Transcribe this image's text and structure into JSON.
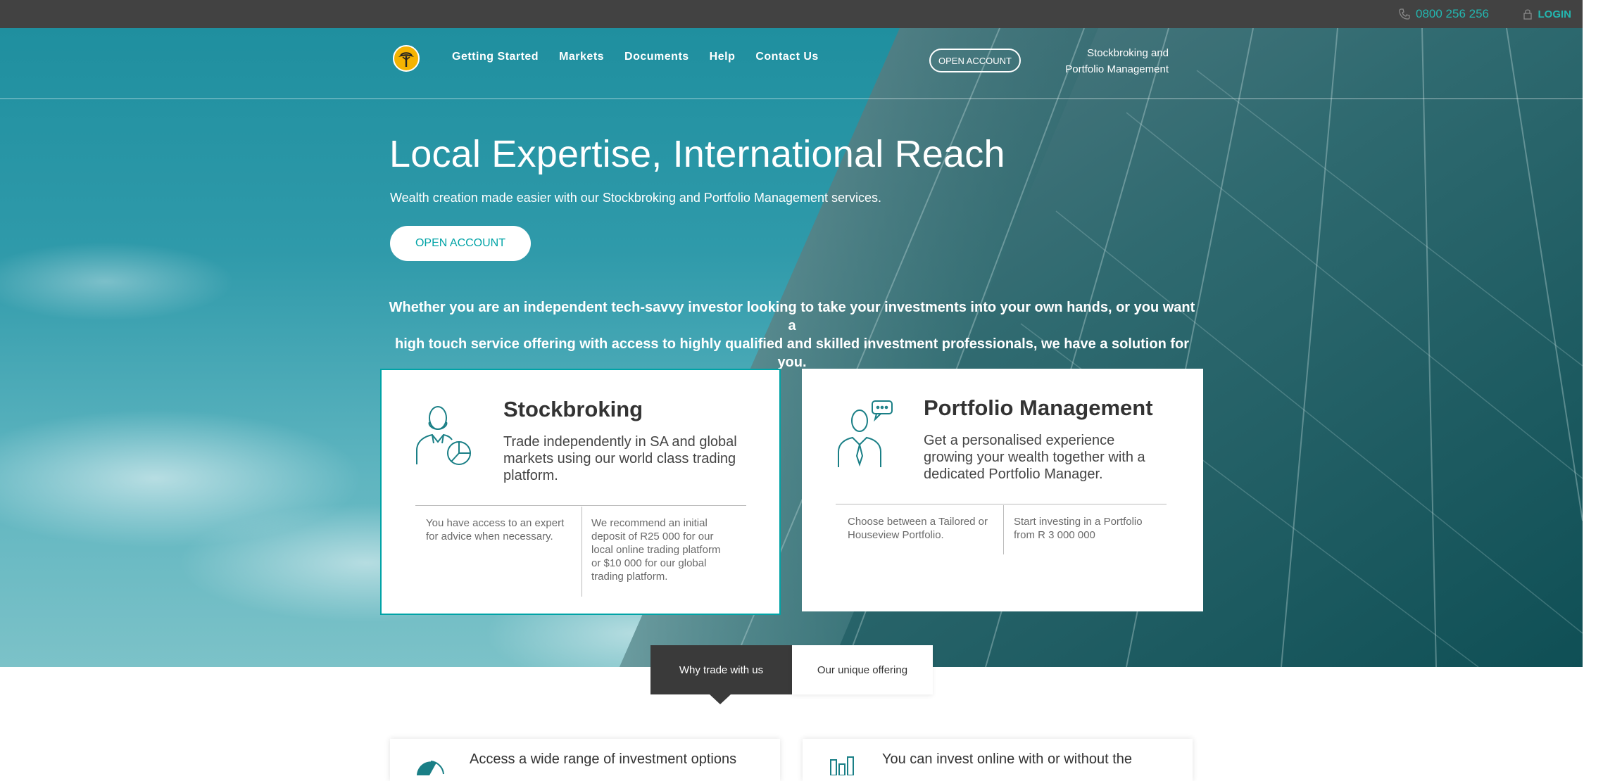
{
  "topbar": {
    "phone": "0800 256 256",
    "phone_icon": "phone-icon",
    "login": "LOGIN",
    "login_icon": "lock-icon",
    "accent": "#23b7b0"
  },
  "nav": {
    "logo_icon": "fnb-tree-logo",
    "items": [
      "Getting Started",
      "Markets",
      "Documents",
      "Help",
      "Contact Us"
    ],
    "open_account": "OPEN ACCOUNT",
    "tagline_line1": "Stockbroking and",
    "tagline_line2": "Portfolio Management"
  },
  "hero": {
    "title": "Local Expertise, International Reach",
    "subtitle": "Wealth creation made easier with our Stockbroking and Portfolio Management services.",
    "cta": "OPEN ACCOUNT",
    "blurb_line1": "Whether you are an independent tech-savvy investor looking to take your investments into your own hands, or you want a",
    "blurb_line2": "high touch service offering with access to highly qualified and skilled investment professionals, we have a solution for you."
  },
  "cards": {
    "stockbroking": {
      "icon": "person-pie-chart-icon",
      "title": "Stockbroking",
      "description": "Trade independently in SA and global markets using our world class trading platform.",
      "col1": "You have access to an expert for advice when necessary.",
      "col2": "We recommend an initial deposit of R25 000 for our local online trading platform or $10 000 for our global trading platform."
    },
    "portfolio": {
      "icon": "person-speech-bubble-icon",
      "title": "Portfolio Management",
      "description": "Get a personalised experience growing your wealth together with a dedicated Portfolio Manager.",
      "col1": "Choose between a Tailored or Houseview Portfolio.",
      "col2": "Start investing in a Portfolio from R 3 000 000"
    }
  },
  "tabs": {
    "active": "Why trade with us",
    "inactive": "Our unique offering"
  },
  "bottom": {
    "left_text": "Access a wide range of investment options",
    "left_icon": "pie-chart-icon",
    "right_text": "You can invest online with or without the",
    "right_icon": "bar-chart-icon"
  },
  "colors": {
    "brand_teal": "#00a3a6",
    "dark_bar": "#424242",
    "tab_dark": "#3a3a3a"
  }
}
